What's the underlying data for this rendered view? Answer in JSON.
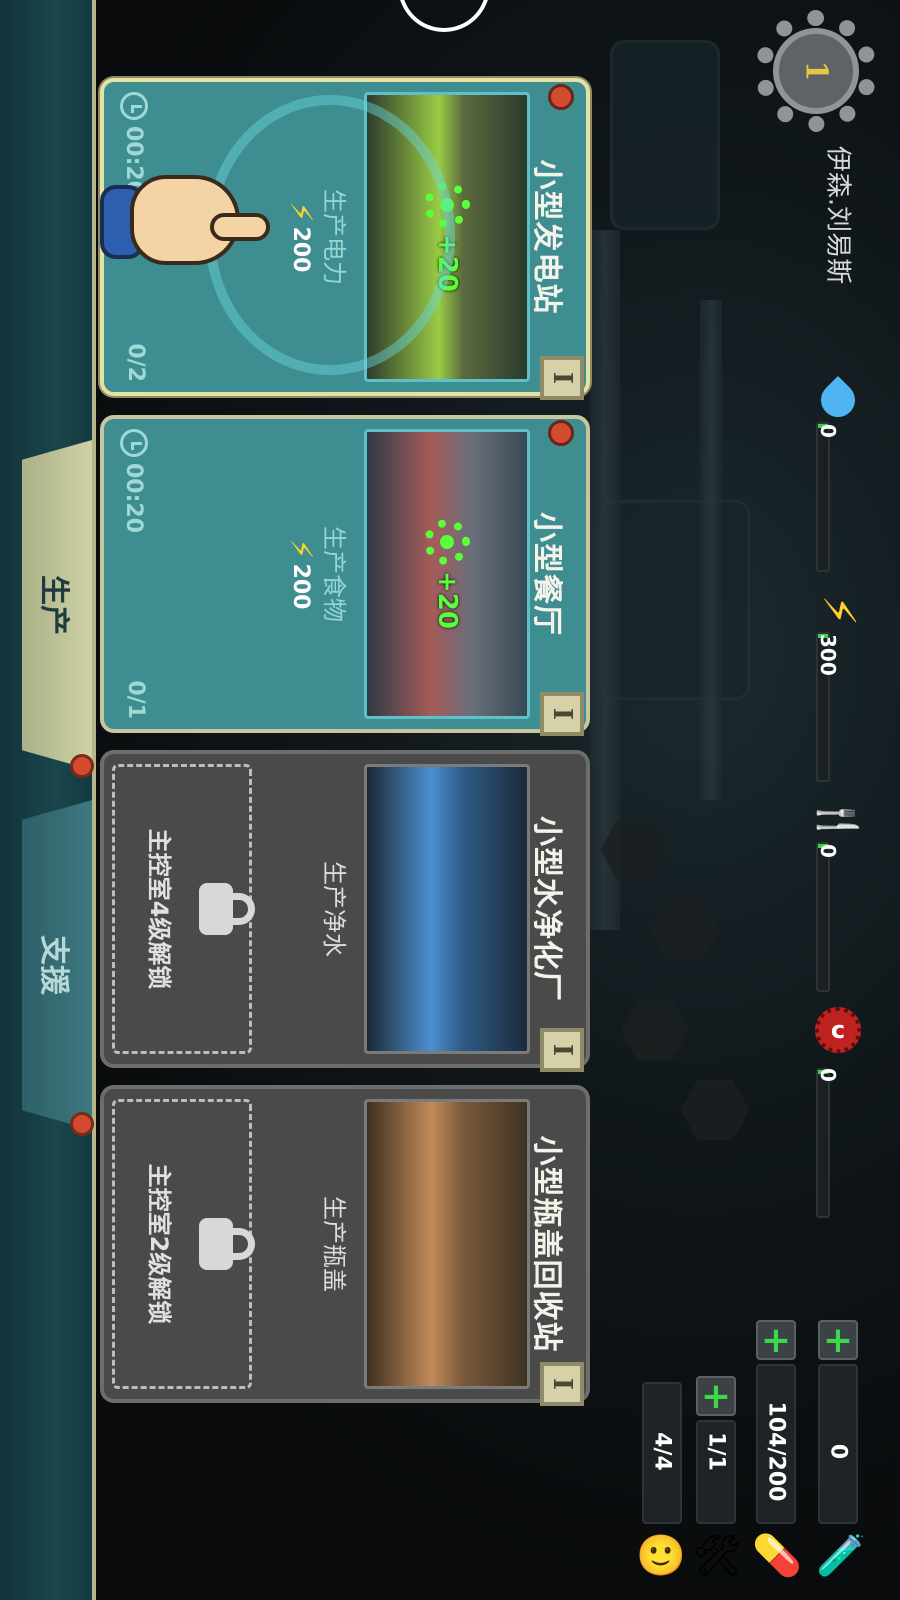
{
  "player": {
    "name": "伊森.刘易斯",
    "level": "1"
  },
  "resources": [
    {
      "name": "water",
      "icon": "water-drop-icon",
      "value": "0",
      "fill": 0.03
    },
    {
      "name": "power",
      "icon": "power-bolt-icon",
      "value": "300",
      "fill": 0.03
    },
    {
      "name": "food",
      "icon": "fork-knife-icon",
      "value": "0",
      "fill": 0.03
    },
    {
      "name": "caps",
      "icon": "bottle-cap-icon",
      "value": "0",
      "fill": 0.03
    }
  ],
  "counters": [
    {
      "name": "nuka",
      "icon": "nuka-bottle-icon",
      "value": "0",
      "has_plus": true
    },
    {
      "name": "stimpak",
      "icon": "stimpak-icon",
      "value": "104/200",
      "has_plus": true
    },
    {
      "name": "tools",
      "icon": "tools-icon",
      "value": "1/1",
      "has_plus": true
    },
    {
      "name": "dwellers",
      "icon": "vault-boy-icon",
      "value": "4/4",
      "has_plus": false
    }
  ],
  "tabs": [
    {
      "label": "生产",
      "active": true
    },
    {
      "label": "支援",
      "active": false
    }
  ],
  "cards": [
    {
      "title": "小型发电站",
      "bonus": "+20",
      "desc": "生产电力",
      "cost": "200",
      "time": "00:20",
      "count": "0/2",
      "locked": false,
      "info": "I"
    },
    {
      "title": "小型餐厅",
      "bonus": "+20",
      "desc": "生产食物",
      "cost": "200",
      "time": "00:20",
      "count": "0/1",
      "locked": false,
      "info": "I"
    },
    {
      "title": "小型水净化厂",
      "desc": "生产净水",
      "locked": true,
      "lock_text": "主控室4级解锁",
      "info": "I"
    },
    {
      "title": "小型瓶盖回收站",
      "desc": "生产瓶盖",
      "locked": true,
      "lock_text": "主控室2级解锁",
      "info": "I"
    }
  ]
}
